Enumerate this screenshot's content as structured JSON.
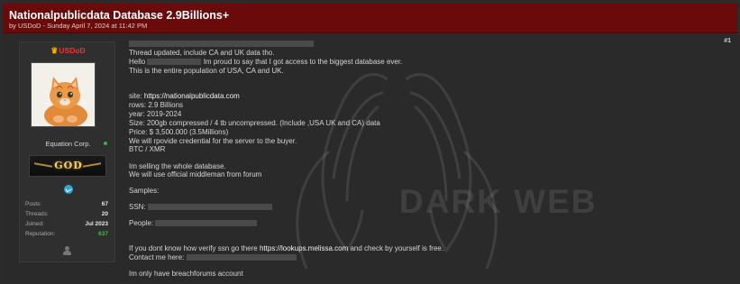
{
  "thread": {
    "title": "Nationalpublicdata Database 2.9Billions+",
    "byline": "by USDoD - Sunday April 7, 2024 at 11:42 PM"
  },
  "user": {
    "name": "USDoD",
    "title": "Equation Corp.",
    "rank": "GOD",
    "stats": [
      {
        "label": "Posts:",
        "value": "67"
      },
      {
        "label": "Threads:",
        "value": "20"
      },
      {
        "label": "Joined:",
        "value": "Jul 2023"
      },
      {
        "label": "Reputation:",
        "value": "637"
      }
    ]
  },
  "post": {
    "number": "#1",
    "watermark": "DARK WEB",
    "lines": {
      "l1": "Thread updated, include CA and UK data tho.",
      "l2a": "Hello",
      "l2b": "Im proud to say that I got access to the biggest database ever.",
      "l3": "This is the entire population of USA, CA and UK.",
      "site_label": "site:",
      "site_url": "https://nationalpublicdata.com",
      "rows": "rows: 2.9 Billions",
      "year": "year: 2019-2024",
      "size": "Size: 200gb compressed / 4 tb uncompressed. (Include ,USA UK and CA) data",
      "price": "Price: $ 3,500.000 (3.5Millions)",
      "cred": "We will rpovide credential for the server to the buyer.",
      "coins": "BTC / XMR",
      "sell": "Im selling the whole database.",
      "middleman": "We will use official middleman from forum",
      "samples": "Samples:",
      "ssn": "SSN:",
      "people": "People:",
      "verify_a": "If you dont know how verify ssn go there",
      "verify_url": "https://lookups.melissa.com",
      "verify_b": "and check by yourself is free.",
      "contact": "Contact me here:",
      "account": "Im only have breachforums account"
    }
  }
}
